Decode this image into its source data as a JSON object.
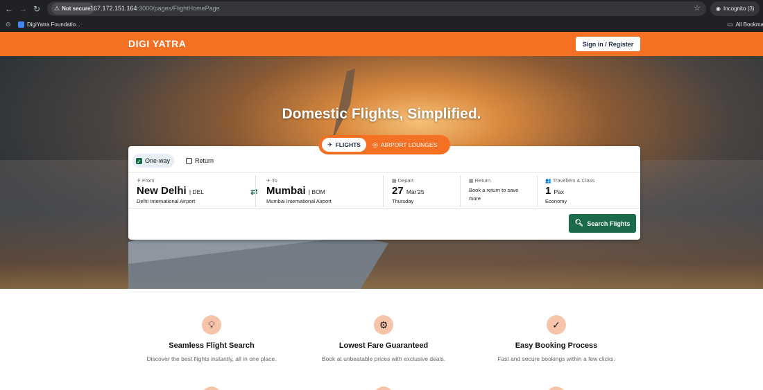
{
  "browser": {
    "security_label": "Not secure",
    "url_host": "167.172.151.164",
    "url_path": ":3000/pages/FlightHomePage",
    "incognito_label": "Incognito (3)",
    "bookmark": "DigiYatra Foundatio...",
    "all_bookmarks": "All Bookmarks"
  },
  "header": {
    "brand": "DIGI YATRA",
    "signin_label": "Sign in / Register",
    "color": "#f47124"
  },
  "hero": {
    "title": "Domestic Flights, Simplified.",
    "tabs": [
      {
        "label": "FLIGHTS",
        "icon": "plane-icon",
        "active": true
      },
      {
        "label": "AIRPORT LOUNGES",
        "icon": "globe-icon",
        "active": false
      }
    ]
  },
  "search": {
    "trip_types": [
      {
        "label": "One-way",
        "checked": true
      },
      {
        "label": "Return",
        "checked": false
      }
    ],
    "from": {
      "label": "From",
      "city": "New Delhi",
      "code": "| DEL",
      "airport": "Delhi International Airport"
    },
    "to": {
      "label": "To",
      "city": "Mumbai",
      "code": "| BOM",
      "airport": "Mumbai International Airport"
    },
    "depart": {
      "label": "Depart",
      "day": "27",
      "month_year": "Mar'25",
      "weekday": "Thursday"
    },
    "return": {
      "label": "Return",
      "description": "Book a return to save more"
    },
    "travellers": {
      "label": "Travellers & Class",
      "count": "1",
      "unit": "Pax",
      "class": "Economy"
    },
    "button_label": "Search Flights",
    "button_color": "#1b6a4a"
  },
  "features": [
    {
      "icon": "lightbulb-icon",
      "title": "Seamless Flight Search",
      "description": "Discover the best flights instantly, all in one place."
    },
    {
      "icon": "gear-badge-icon",
      "title": "Lowest Fare Guaranteed",
      "description": "Book at unbeatable prices with exclusive deals."
    },
    {
      "icon": "checkmark-icon",
      "title": "Easy Booking Process",
      "description": "Fast and secure bookings within a few clicks."
    }
  ]
}
